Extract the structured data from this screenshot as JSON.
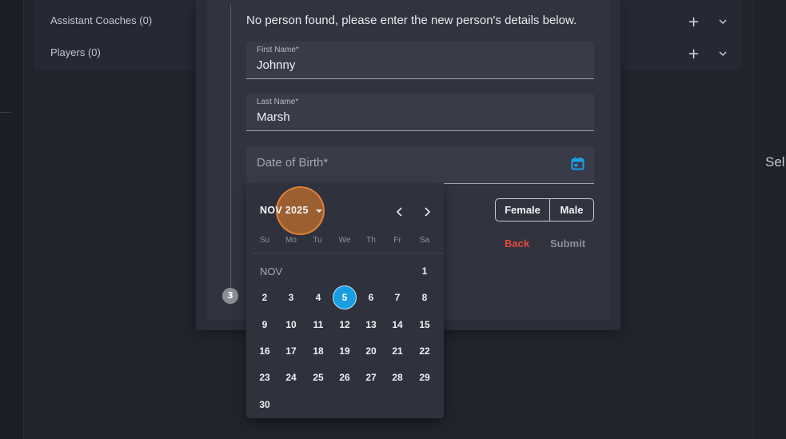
{
  "background": {
    "team_sections": [
      {
        "label": "Assistant Coaches (0)"
      },
      {
        "label": "Players (0)"
      }
    ],
    "right_panel_text": "Sel"
  },
  "modal": {
    "step_number": "3",
    "prompt": "No person found, please enter the new person's details below.",
    "first_name": {
      "label": "First Name*",
      "value": "Johnny"
    },
    "last_name": {
      "label": "Last Name*",
      "value": "Marsh"
    },
    "dob": {
      "placeholder": "Date of Birth*",
      "value": ""
    },
    "gender": {
      "female": "Female",
      "male": "Male"
    },
    "back_label": "Back",
    "submit_label": "Submit"
  },
  "calendar": {
    "header": "NOV 2025",
    "month_label": "NOV",
    "weekdays": [
      "Su",
      "Mo",
      "Tu",
      "We",
      "Th",
      "Fr",
      "Sa"
    ],
    "days": [
      "1",
      "2",
      "3",
      "4",
      "5",
      "6",
      "7",
      "8",
      "9",
      "10",
      "11",
      "12",
      "13",
      "14",
      "15",
      "16",
      "17",
      "18",
      "19",
      "20",
      "21",
      "22",
      "23",
      "24",
      "25",
      "26",
      "27",
      "28",
      "29",
      "30"
    ],
    "selected_day": "5"
  },
  "colors": {
    "accent": "#1a9ee3",
    "back": "#e3483b",
    "highlight": "#de7c2c"
  }
}
